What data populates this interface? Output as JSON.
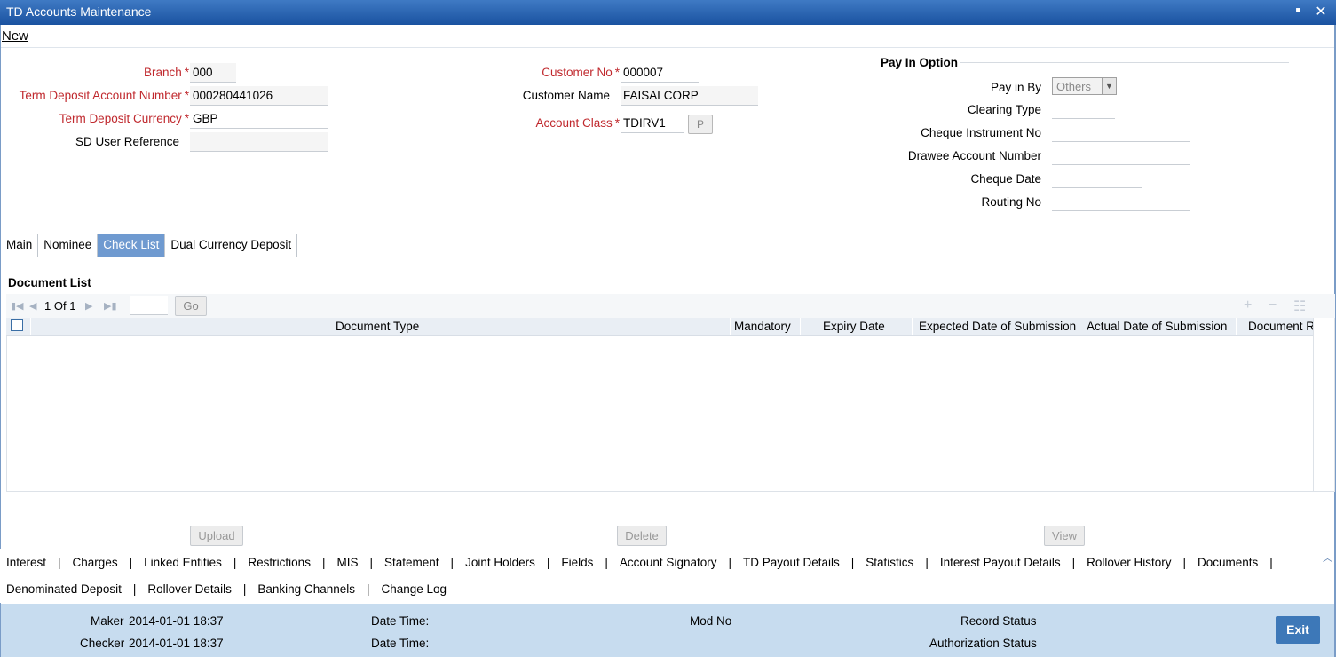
{
  "window": {
    "title": "TD Accounts Maintenance",
    "minimize": "▪",
    "close": "✕"
  },
  "menu": {
    "new": "New"
  },
  "header": {
    "branch_label": "Branch",
    "branch_value": "000",
    "td_account_label": "Term Deposit Account Number",
    "td_account_value": "000280441026",
    "td_currency_label": "Term Deposit Currency",
    "td_currency_value": "GBP",
    "sd_user_ref_label": "SD User Reference",
    "sd_user_ref_value": "",
    "customer_no_label": "Customer No",
    "customer_no_value": "000007",
    "customer_name_label": "Customer Name",
    "customer_name_value": "FAISALCORP",
    "account_class_label": "Account Class",
    "account_class_value": "TDIRV1",
    "account_class_btn": "P",
    "required_mark": "*"
  },
  "pay_in": {
    "title": "Pay In Option",
    "pay_in_by_label": "Pay in By",
    "pay_in_by_value": "Others",
    "clearing_type_label": "Clearing Type",
    "cheque_instrument_label": "Cheque Instrument No",
    "drawee_account_label": "Drawee Account Number",
    "cheque_date_label": "Cheque Date",
    "routing_no_label": "Routing No"
  },
  "tabs": [
    {
      "label": "Main",
      "active": false
    },
    {
      "label": "Nominee",
      "active": false
    },
    {
      "label": "Check List",
      "active": true
    },
    {
      "label": "Dual Currency Deposit",
      "active": false
    }
  ],
  "document_list": {
    "title": "Document List",
    "pager_current": "1",
    "pager_of": "Of",
    "pager_total": "1",
    "go_label": "Go",
    "columns": [
      "Document Type",
      "Mandatory",
      "Expiry Date",
      "Expected Date of Submission",
      "Actual Date of Submission",
      "Document R"
    ],
    "rows": []
  },
  "actions": {
    "upload": "Upload",
    "delete": "Delete",
    "view": "View"
  },
  "links_row1": [
    "Interest",
    "Charges",
    "Linked Entities",
    "Restrictions",
    "MIS",
    "Statement",
    "Joint Holders",
    "Fields",
    "Account Signatory",
    "TD Payout Details",
    "Statistics",
    "Interest Payout Details",
    "Rollover History",
    "Documents"
  ],
  "links_row2": [
    "Denominated Deposit",
    "Rollover Details",
    "Banking Channels",
    "Change Log"
  ],
  "link_separator": "|",
  "footer": {
    "maker_label": "Maker",
    "maker_value": "2014-01-01 18:37",
    "checker_label": "Checker",
    "checker_value": "2014-01-01 18:37",
    "date_time_label": "Date Time:",
    "mod_no_label": "Mod No",
    "record_status_label": "Record Status",
    "auth_status_label": "Authorization Status",
    "exit_label": "Exit"
  }
}
